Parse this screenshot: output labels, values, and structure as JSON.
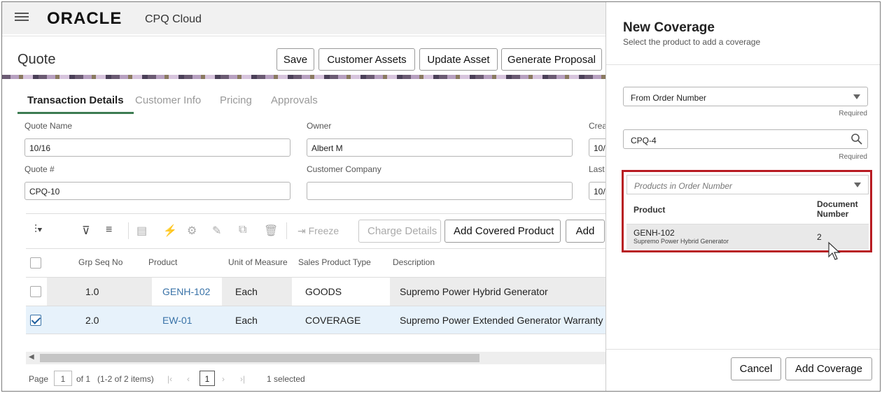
{
  "brand": {
    "logo": "ORACLE",
    "product": "CPQ Cloud"
  },
  "page": {
    "title": "Quote",
    "actions": [
      "Save",
      "Customer Assets",
      "Update Asset",
      "Generate Proposal"
    ]
  },
  "tabs": [
    "Transaction Details",
    "Customer Info",
    "Pricing",
    "Approvals"
  ],
  "form": {
    "quote_name_label": "Quote Name",
    "quote_name": "10/16",
    "owner_label": "Owner",
    "owner": "Albert M",
    "created_label": "Crea",
    "created": "10/",
    "quote_num_label": "Quote #",
    "quote_num": "CPQ-10",
    "customer_company_label": "Customer Company",
    "customer_company": "",
    "last_label": "Last",
    "last": "10/"
  },
  "grid_toolbar": {
    "freeze": "Freeze",
    "charge_details": "Charge Details",
    "add_covered_product": "Add Covered Product",
    "add": "Add"
  },
  "grid": {
    "columns": [
      "Grp Seq No",
      "Product",
      "Unit of Measure",
      "Sales Product Type",
      "Description"
    ],
    "rows": [
      {
        "seq": "1.0",
        "product": "GENH-102",
        "uom": "Each",
        "type": "GOODS",
        "description": "Supremo Power Hybrid Generator",
        "selected": false
      },
      {
        "seq": "2.0",
        "product": "EW-01",
        "uom": "Each",
        "type": "COVERAGE",
        "description": "Supremo Power Extended Generator Warranty",
        "selected": true
      }
    ]
  },
  "pager": {
    "page_label": "Page",
    "page": "1",
    "of": "of 1",
    "items": "(1-2 of 2 items)",
    "current": "1",
    "selected": "1 selected"
  },
  "drawer": {
    "title": "New Coverage",
    "subtitle": "Select the product to add a coverage",
    "source_select": "From Order Number",
    "required": "Required",
    "order_number": "CPQ-4",
    "products_placeholder": "Products in Order Number",
    "product_col": "Product",
    "doc_col_line1": "Document",
    "doc_col_line2": "Number",
    "product_row": {
      "product": "GENH-102",
      "description": "Supremo Power Hybrid Generator",
      "doc_number": "2"
    },
    "cancel": "Cancel",
    "add_coverage": "Add Coverage"
  },
  "colors": {
    "accent_tab": "#3d7c52",
    "highlight": "#b81b22",
    "link": "#3a73a8",
    "selected_row": "#e7f2fb"
  }
}
